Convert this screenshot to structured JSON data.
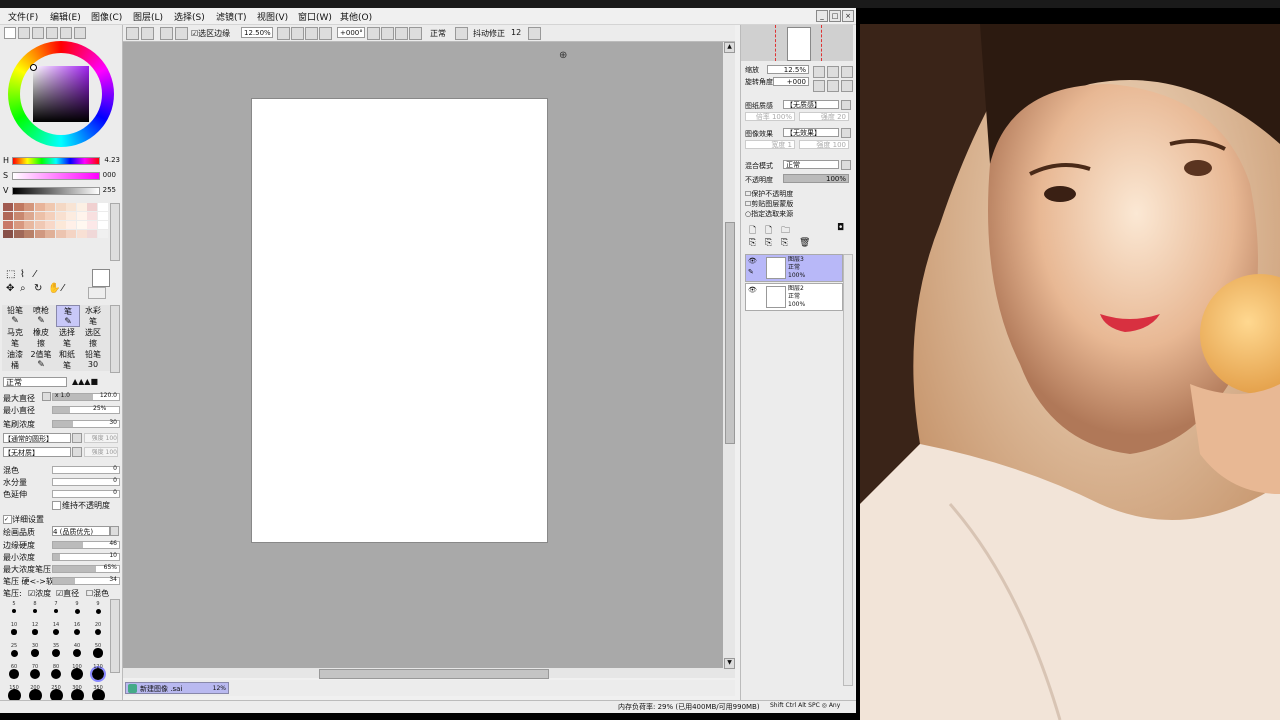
{
  "menu": {
    "items": [
      "文件(F)",
      "编辑(E)",
      "图像(C)",
      "图层(L)",
      "选择(S)",
      "滤镜(T)",
      "视图(V)",
      "窗口(W)",
      "其他(O)"
    ]
  },
  "toolbar": {
    "selection_check_label": "选区边缘",
    "zoom": "12.50%",
    "angle": "+000°",
    "blend_mode": "正常",
    "stabilizer_label": "抖动修正",
    "stabilizer_value": "12"
  },
  "color": {
    "h_label": "H",
    "h_value": "4.23",
    "s_label": "S",
    "s_value": "000",
    "v_label": "V",
    "v_value": "255",
    "hue_ring_colors": [
      "#ff0000",
      "#ffff00",
      "#00ff00",
      "#00ffff",
      "#0000ff",
      "#ff00ff",
      "#ff0000"
    ],
    "picker_base": "#a020f0",
    "swatches": [
      "#a05a50",
      "#c07860",
      "#d4967c",
      "#e8b49a",
      "#f0c8b0",
      "#f4d8c4",
      "#f8e4d4",
      "#fcf0e4",
      "#f0d0d0",
      "#ffffff",
      "#b06858",
      "#c88870",
      "#dca890",
      "#ecc0a8",
      "#f4d0bc",
      "#f8e0d0",
      "#fcece0",
      "#fff4ec",
      "#f8e0e0",
      "#ffffff",
      "#c87868",
      "#d89880",
      "#e8b8a0",
      "#f0c8b4",
      "#f8d8c8",
      "#fce8d8",
      "#fff0e8",
      "#fff8f0",
      "#fce8e8",
      "#ffffff",
      "#885048",
      "#a06858",
      "#b88068",
      "#d09880",
      "#e0b098",
      "#ecc4b0",
      "#f4d4c4",
      "#f8e0d4",
      "#f0d8d8",
      "#f0f0f0"
    ]
  },
  "tools": {
    "row1": [
      "铅笔",
      "喷枪",
      "笔",
      "水彩笔"
    ],
    "row2": [
      "马克笔",
      "橡皮擦",
      "选择笔",
      "选区擦"
    ],
    "row3": [
      "油漆桶",
      "2值笔",
      "和纸笔",
      "铅笔30"
    ],
    "active": "笔"
  },
  "brush": {
    "mode": "正常",
    "max_size_label": "最大直径",
    "max_size_mult": "x 1.0",
    "max_size_value": "120.0",
    "max_size_fill": 0.6,
    "min_size_label": "最小直径",
    "min_size_value": "25%",
    "min_size_fill": 0.25,
    "density_label": "笔刷浓度",
    "density_value": "30",
    "density_fill": 0.3,
    "shape_label": "【通常的圆形】",
    "shape_strength": "强度 100",
    "texture_label": "【无材质】",
    "texture_strength": "强度 100",
    "blend_label": "混色",
    "blend_value": "0",
    "water_label": "水分量",
    "water_value": "0",
    "persist_label": "色延伸",
    "persist_value": "0",
    "keep_opacity_label": "维持不透明度",
    "detail_label": "详细设置",
    "quality_label": "绘画品质",
    "quality_value": "4 (品质优先)",
    "edge_label": "边缘硬度",
    "edge_value": "46",
    "edge_fill": 0.46,
    "min_density_label": "最小浓度",
    "min_density_value": "10",
    "min_density_fill": 0.1,
    "max_pressure_label": "最大浓度笔压",
    "max_pressure_value": "65%",
    "max_pressure_fill": 0.65,
    "pressure_hard_label": "笔压 硬<->软",
    "pressure_hard_value": "34",
    "pressure_hard_fill": 0.34,
    "pressure_label": "笔压:",
    "pressure_opts": [
      "浓度",
      "直径",
      "混色"
    ]
  },
  "brush_sizes": {
    "row1": [
      "5",
      "8",
      "7",
      "9",
      "9"
    ],
    "row2": [
      "10",
      "12",
      "14",
      "16",
      "20"
    ],
    "row3": [
      "25",
      "30",
      "35",
      "40",
      "50"
    ],
    "row4": [
      "60",
      "70",
      "80",
      "100",
      "120"
    ],
    "row5": [
      "150",
      "200",
      "250",
      "300",
      "350"
    ],
    "selected": "120"
  },
  "right": {
    "zoom_label": "缩放",
    "zoom_value": "12.5%",
    "rotate_label": "旋转角度",
    "rotate_value": "+000",
    "paper_tex_label": "图纸质感",
    "paper_tex_value": "【无质感】",
    "paper_tex_sub": "倍率 100%",
    "paper_tex_sub2": "强度 20",
    "paper_fx_label": "图像效果",
    "paper_fx_value": "【无效果】",
    "paper_fx_sub": "宽度 1",
    "paper_fx_sub2": "强度 100",
    "blend_label": "混合模式",
    "blend_value": "正常",
    "opacity_label": "不透明度",
    "opacity_value": "100%",
    "check1": "保护不透明度",
    "check2": "剪贴图层蒙版",
    "check3": "指定选取来源"
  },
  "layers": [
    {
      "name": "图层3",
      "mode": "正常",
      "opacity": "100%",
      "selected": true
    },
    {
      "name": "图层2",
      "mode": "正常",
      "opacity": "100%",
      "selected": false
    }
  ],
  "document": {
    "tab": "新建图像 .sai",
    "tab_zoom": "12%"
  },
  "status": {
    "memory": "内存负荷率: 29% (已用400MB/可用990MB)",
    "keys": "Shift Ctrl Alt SPC ◎ Any"
  }
}
